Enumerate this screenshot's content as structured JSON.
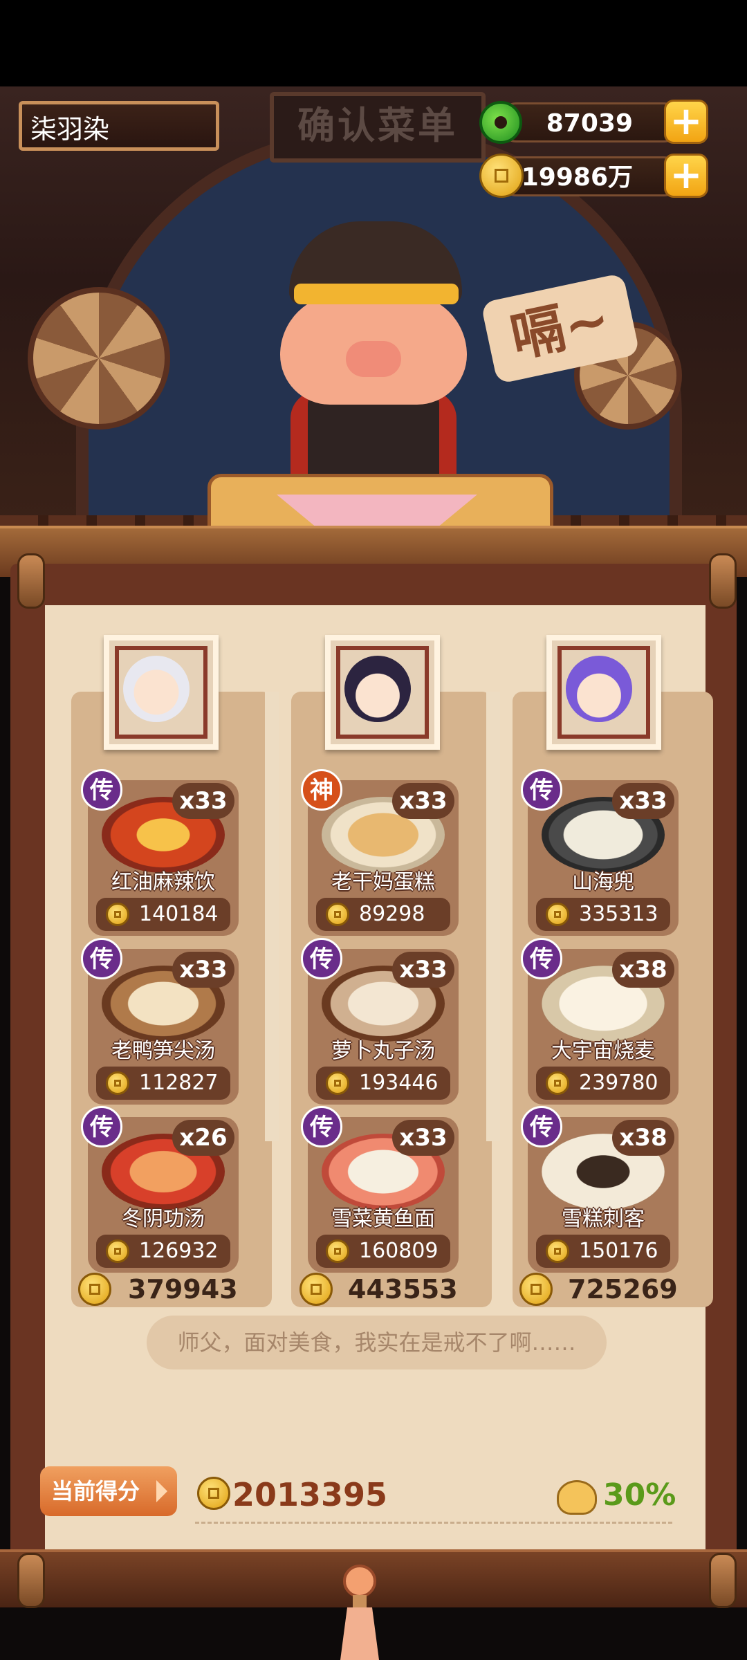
{
  "player": {
    "name": "柒羽染"
  },
  "scene": {
    "sign": "确认菜单",
    "speech": "嗝~"
  },
  "currency": {
    "jade": "87039",
    "coins": "119986万"
  },
  "chefs": [
    {
      "total": "379943",
      "dishes": [
        {
          "badge": "传",
          "name": "红油麻辣饮",
          "qty": "x33",
          "price": "140184"
        },
        {
          "badge": "传",
          "name": "老鸭笋尖汤",
          "qty": "x33",
          "price": "112827"
        },
        {
          "badge": "传",
          "name": "冬阴功汤",
          "qty": "x26",
          "price": "126932"
        }
      ]
    },
    {
      "total": "443553",
      "dishes": [
        {
          "badge": "神",
          "name": "老干妈蛋糕",
          "qty": "x33",
          "price": "89298"
        },
        {
          "badge": "传",
          "name": "萝卜丸子汤",
          "qty": "x33",
          "price": "193446"
        },
        {
          "badge": "传",
          "name": "雪菜黄鱼面",
          "qty": "x33",
          "price": "160809"
        }
      ]
    },
    {
      "total": "725269",
      "dishes": [
        {
          "badge": "传",
          "name": "山海兜",
          "qty": "x33",
          "price": "335313"
        },
        {
          "badge": "传",
          "name": "大宇宙烧麦",
          "qty": "x38",
          "price": "239780"
        },
        {
          "badge": "传",
          "name": "雪糕刺客",
          "qty": "x38",
          "price": "150176"
        }
      ]
    }
  ],
  "quote": "师父，面对美食，我实在是戒不了啊……",
  "score": {
    "label": "当前得分",
    "value": "2013395",
    "bonus": "30%"
  }
}
